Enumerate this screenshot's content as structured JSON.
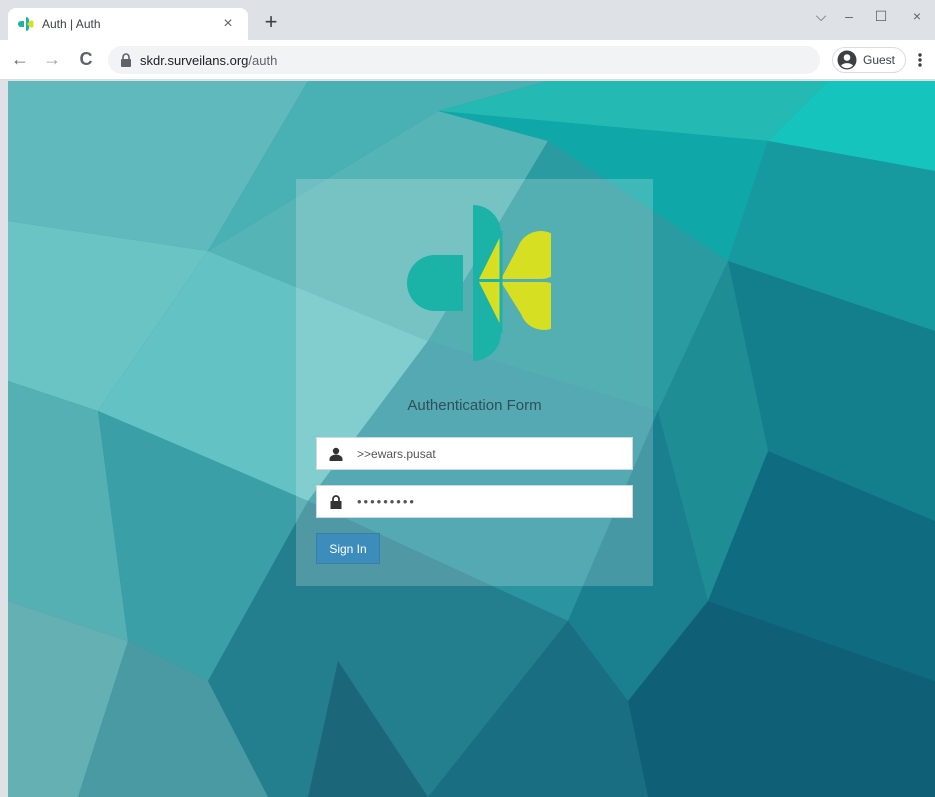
{
  "tab": {
    "title": "Auth | Auth",
    "close": "×"
  },
  "new_tab": "+",
  "window": {
    "minimize": "–",
    "maximize": "☐",
    "close": "×",
    "tab_search": "⌵"
  },
  "nav": {
    "back": "←",
    "forward": "→",
    "reload": "C"
  },
  "omnibox": {
    "host": "skdr.surveilans.org",
    "path": "/auth"
  },
  "profile": {
    "label": "Guest"
  },
  "form": {
    "title": "Authentication Form",
    "username_value": ">>ewars.pusat",
    "password_value": "•••••••••",
    "signin_label": "Sign In"
  },
  "colors": {
    "brand_teal": "#1bb3a7",
    "brand_lime": "#d7df23",
    "button": "#3c8dbc"
  }
}
